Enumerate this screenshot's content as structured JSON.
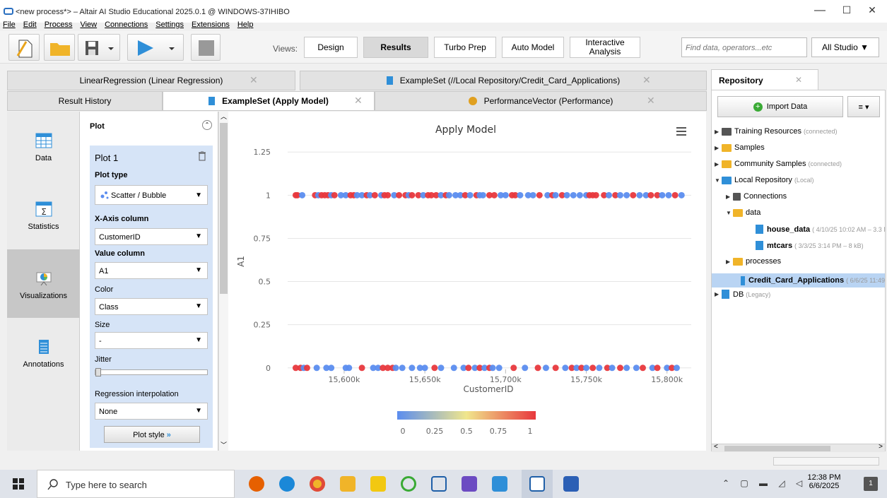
{
  "window": {
    "title": "<new process*> – Altair AI Studio Educational 2025.0.1 @ WINDOWS-37IHIBO",
    "min": "—",
    "max": "☐",
    "close": "✕"
  },
  "menu": [
    "File",
    "Edit",
    "Process",
    "View",
    "Connections",
    "Settings",
    "Extensions",
    "Help"
  ],
  "toolbar": {
    "views_label": "Views:",
    "views": [
      "Design",
      "Results",
      "Turbo Prep",
      "Auto Model",
      "Interactive Analysis"
    ],
    "active_view": "Results",
    "search_placeholder": "Find data, operators...etc",
    "all_studio": "All Studio ▼"
  },
  "tabs_row1": [
    "LinearRegression (Linear Regression)",
    "ExampleSet (//Local Repository/Credit_Card_Applications)"
  ],
  "tabs_row2": [
    "Result History",
    "ExampleSet (Apply Model)",
    "PerformanceVector (Performance)"
  ],
  "leftnav": [
    "Data",
    "Statistics",
    "Visualizations",
    "Annotations"
  ],
  "plot_panel": {
    "header": "Plot",
    "plot_name": "Plot 1",
    "plot_type_label": "Plot type",
    "plot_type": "Scatter / Bubble",
    "x_label": "X-Axis column",
    "x_value": "CustomerID",
    "value_label": "Value column",
    "value_value": "A1",
    "color_label": "Color",
    "color_value": "Class",
    "size_label": "Size",
    "size_value": "-",
    "jitter_label": "Jitter",
    "jitter_level": 0,
    "regression_label": "Regression interpolation",
    "regression_value": "None",
    "plot_style": "Plot style"
  },
  "chart_data": {
    "type": "scatter",
    "title": "Apply Model",
    "xlabel": "CustomerID",
    "ylabel": "A1",
    "xlim": [
      15565,
      15815
    ],
    "ylim": [
      -0.05,
      1.3
    ],
    "x_ticks": [
      "15,600k",
      "15,650k",
      "15,700k",
      "15,750k",
      "15,800k"
    ],
    "x_tick_values": [
      15600,
      15650,
      15700,
      15750,
      15800
    ],
    "y_ticks": [
      "0",
      "0.25",
      "0.5",
      "0.75",
      "1",
      "1.25"
    ],
    "y_tick_values": [
      0,
      0.25,
      0.5,
      0.75,
      1,
      1.25
    ],
    "grid": true,
    "color_scale": {
      "low": "#5b8def",
      "mid": "#f0e68c",
      "high": "#e8383d",
      "ticks": [
        "0",
        "0.25",
        "0.5",
        "0.75",
        "1"
      ]
    },
    "series": [
      {
        "y": 1,
        "points": [
          [
            15570,
            1
          ],
          [
            15571,
            1
          ],
          [
            15574,
            0
          ],
          [
            15582,
            1
          ],
          [
            15584,
            0
          ],
          [
            15586,
            1
          ],
          [
            15588,
            1
          ],
          [
            15590,
            1
          ],
          [
            15592,
            0
          ],
          [
            15594,
            1
          ],
          [
            15598,
            0
          ],
          [
            15601,
            0
          ],
          [
            15604,
            1
          ],
          [
            15606,
            1
          ],
          [
            15608,
            0
          ],
          [
            15611,
            0
          ],
          [
            15614,
            1
          ],
          [
            15616,
            0
          ],
          [
            15619,
            1
          ],
          [
            15623,
            0
          ],
          [
            15625,
            1
          ],
          [
            15627,
            1
          ],
          [
            15631,
            0
          ],
          [
            15634,
            1
          ],
          [
            15638,
            1
          ],
          [
            15640,
            0
          ],
          [
            15642,
            1
          ],
          [
            15646,
            1
          ],
          [
            15649,
            0
          ],
          [
            15652,
            1
          ],
          [
            15654,
            1
          ],
          [
            15657,
            1
          ],
          [
            15660,
            0
          ],
          [
            15663,
            1
          ],
          [
            15665,
            0
          ],
          [
            15669,
            0
          ],
          [
            15672,
            0
          ],
          [
            15675,
            1
          ],
          [
            15678,
            0
          ],
          [
            15682,
            1
          ],
          [
            15684,
            0
          ],
          [
            15686,
            0
          ],
          [
            15690,
            1
          ],
          [
            15693,
            1
          ],
          [
            15697,
            0
          ],
          [
            15700,
            0
          ],
          [
            15704,
            1
          ],
          [
            15706,
            1
          ],
          [
            15709,
            0
          ],
          [
            15714,
            0
          ],
          [
            15717,
            0
          ],
          [
            15721,
            1
          ],
          [
            15726,
            0
          ],
          [
            15729,
            1
          ],
          [
            15731,
            0
          ],
          [
            15735,
            1
          ],
          [
            15738,
            0
          ],
          [
            15742,
            0
          ],
          [
            15746,
            0
          ],
          [
            15750,
            0
          ],
          [
            15752,
            1
          ],
          [
            15754,
            1
          ],
          [
            15756,
            1
          ],
          [
            15761,
            1
          ],
          [
            15764,
            0
          ],
          [
            15768,
            1
          ],
          [
            15771,
            0
          ],
          [
            15775,
            0
          ],
          [
            15779,
            1
          ],
          [
            15783,
            0
          ],
          [
            15787,
            0
          ],
          [
            15790,
            1
          ],
          [
            15794,
            1
          ],
          [
            15797,
            0
          ],
          [
            15801,
            0
          ],
          [
            15805,
            1
          ],
          [
            15809,
            0
          ]
        ]
      },
      {
        "y": 0,
        "points": [
          [
            15570,
            1
          ],
          [
            15573,
            1
          ],
          [
            15575,
            0
          ],
          [
            15577,
            1
          ],
          [
            15583,
            0
          ],
          [
            15589,
            0
          ],
          [
            15592,
            0
          ],
          [
            15601,
            0
          ],
          [
            15603,
            0
          ],
          [
            15611,
            1
          ],
          [
            15618,
            0
          ],
          [
            15621,
            0
          ],
          [
            15624,
            1
          ],
          [
            15627,
            1
          ],
          [
            15630,
            1
          ],
          [
            15632,
            0
          ],
          [
            15636,
            0
          ],
          [
            15642,
            0
          ],
          [
            15647,
            0
          ],
          [
            15650,
            0
          ],
          [
            15656,
            1
          ],
          [
            15660,
            0
          ],
          [
            15668,
            0
          ],
          [
            15674,
            0
          ],
          [
            15677,
            1
          ],
          [
            15681,
            0
          ],
          [
            15684,
            1
          ],
          [
            15687,
            0
          ],
          [
            15690,
            1
          ],
          [
            15692,
            0
          ],
          [
            15696,
            0
          ],
          [
            15705,
            1
          ],
          [
            15712,
            0
          ],
          [
            15720,
            1
          ],
          [
            15725,
            0
          ],
          [
            15731,
            1
          ],
          [
            15737,
            0
          ],
          [
            15741,
            1
          ],
          [
            15744,
            0
          ],
          [
            15747,
            1
          ],
          [
            15750,
            0
          ],
          [
            15754,
            1
          ],
          [
            15758,
            0
          ],
          [
            15763,
            1
          ],
          [
            15766,
            0
          ],
          [
            15771,
            1
          ],
          [
            15775,
            0
          ],
          [
            15781,
            0
          ],
          [
            15785,
            1
          ],
          [
            15791,
            0
          ],
          [
            15794,
            1
          ],
          [
            15800,
            0
          ],
          [
            15803,
            1
          ],
          [
            15806,
            0
          ]
        ]
      }
    ]
  },
  "repository": {
    "tab": "Repository",
    "import": "Import Data",
    "menu": "≡ ▾",
    "items": [
      {
        "name": "Training Resources",
        "sub": "(connected)",
        "indent": 0,
        "icon": "training-icon",
        "tri": "▶"
      },
      {
        "name": "Samples",
        "sub": "",
        "indent": 0,
        "icon": "folder-icon",
        "tri": "▶"
      },
      {
        "name": "Community Samples",
        "sub": "(connected)",
        "indent": 0,
        "icon": "community-icon",
        "tri": "▶"
      },
      {
        "name": "Local Repository",
        "sub": "(Local)",
        "indent": 0,
        "icon": "local-repo-icon",
        "tri": "▼"
      },
      {
        "name": "Connections",
        "sub": "",
        "indent": 1,
        "icon": "connections-icon",
        "tri": "▶"
      },
      {
        "name": "data",
        "sub": "",
        "indent": 1,
        "icon": "folder-icon",
        "tri": "▼"
      },
      {
        "name": "house_data",
        "sub": "( 4/10/25 10:02 AM – 3.3 M",
        "indent": 3,
        "icon": "data-icon",
        "tri": ""
      },
      {
        "name": "mtcars",
        "sub": "( 3/3/25 3:14 PM – 8 kB)",
        "indent": 3,
        "icon": "data-icon",
        "tri": ""
      },
      {
        "name": "processes",
        "sub": "",
        "indent": 1,
        "icon": "folder-icon",
        "tri": "▶"
      },
      {
        "name": "Credit_Card_Applications",
        "sub": "( 6/6/25 11:49",
        "indent": 2,
        "icon": "data-icon",
        "tri": "",
        "selected": true
      },
      {
        "name": "DB",
        "sub": "(Legacy)",
        "indent": 0,
        "icon": "db-icon",
        "tri": "▶"
      }
    ]
  },
  "taskbar": {
    "search": "Type here to search",
    "time": "12:38 PM",
    "date": "6/6/2025",
    "notif": "1"
  }
}
